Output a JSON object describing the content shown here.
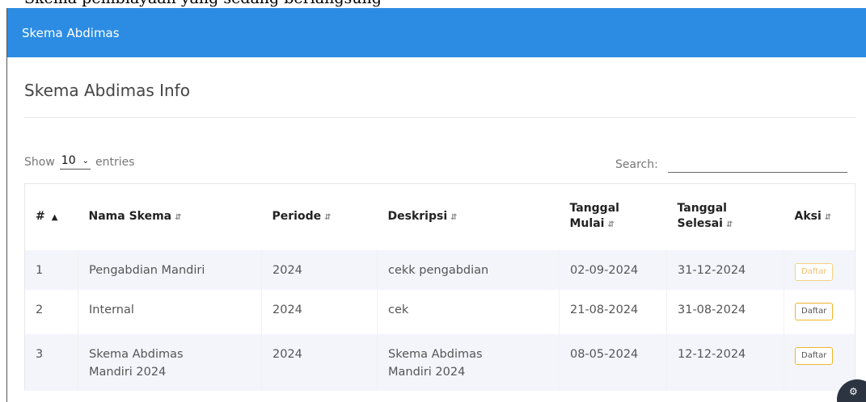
{
  "page_top_text": "Skema pembiayaan yang sedang berlangsung",
  "header": {
    "title": "Skema Abdimas"
  },
  "section": {
    "title": "Skema Abdimas Info"
  },
  "length_control": {
    "prefix": "Show",
    "value": "10",
    "suffix": "entries"
  },
  "search": {
    "label": "Search:",
    "value": ""
  },
  "table": {
    "columns": [
      {
        "label_line1": "#",
        "label_line2": ""
      },
      {
        "label_line1": "Nama Skema",
        "label_line2": ""
      },
      {
        "label_line1": "Periode",
        "label_line2": ""
      },
      {
        "label_line1": "Deskripsi",
        "label_line2": ""
      },
      {
        "label_line1": "Tanggal",
        "label_line2": "Mulai"
      },
      {
        "label_line1": "Tanggal",
        "label_line2": "Selesai"
      },
      {
        "label_line1": "Aksi",
        "label_line2": ""
      }
    ],
    "rows": [
      {
        "no": "1",
        "nama_line1": "Pengabdian Mandiri",
        "nama_line2": "",
        "periode": "2024",
        "deskripsi_line1": "cekk pengabdian",
        "deskripsi_line2": "",
        "mulai": "02-09-2024",
        "selesai": "31-12-2024",
        "aksi": "Daftar",
        "aksi_disabled": true
      },
      {
        "no": "2",
        "nama_line1": "Internal",
        "nama_line2": "",
        "periode": "2024",
        "deskripsi_line1": "cek",
        "deskripsi_line2": "",
        "mulai": "21-08-2024",
        "selesai": "31-08-2024",
        "aksi": "Daftar",
        "aksi_disabled": false
      },
      {
        "no": "3",
        "nama_line1": "Skema Abdimas",
        "nama_line2": "Mandiri 2024",
        "periode": "2024",
        "deskripsi_line1": "Skema Abdimas",
        "deskripsi_line2": "Mandiri 2024",
        "mulai": "08-05-2024",
        "selesai": "12-12-2024",
        "aksi": "Daftar",
        "aksi_disabled": false
      }
    ]
  },
  "icons": {
    "sort_asc": "sort-asc-icon",
    "sort_both": "sort-both-icon",
    "dropdown": "chevron-down-icon",
    "settings": "gear-icon"
  },
  "colors": {
    "header_bg": "#2c8ce3",
    "button_border": "#f0b429",
    "row_stripe": "#f4f5fb"
  }
}
